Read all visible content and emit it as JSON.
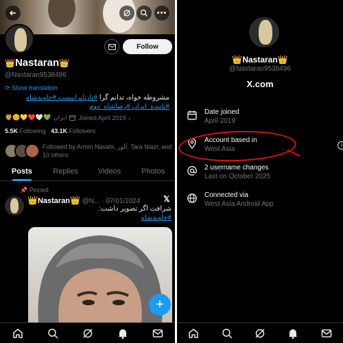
{
  "left": {
    "profile": {
      "name": "Nastaran",
      "crown_glyph": "👑",
      "handle": "@Nastaran9538496",
      "follow_label": "Follow",
      "show_translation": "Show translation",
      "bio_line1_text": "مشروطه خواه، تدانم گرا",
      "bio_line1_tags": "#یان‌ایرانیست #جاویدشاه",
      "bio_line2_tags": "#پاینده_ایران #رضاشاه_دوم",
      "location": "ایران",
      "joined": "Joined April 2019",
      "following_count": "5.5K",
      "following_label": "Following",
      "followers_count": "43.1K",
      "followers_label": "Followers",
      "followed_by": "Followed by Armin Navabi, آلور, Tara Niazi, and 10 others"
    },
    "tabs": [
      "Posts",
      "Replies",
      "Videos",
      "Photos"
    ],
    "post": {
      "pinned_label": "Pinned",
      "author": "Nastaran",
      "handle_date": "@N... · 07/01/2024",
      "text_line1": "شرافت اگر تصویر داشت:",
      "text_tag": "#جاویدشاه"
    },
    "nav_icons": [
      "home-icon",
      "search-icon",
      "grok-icon",
      "notifications-icon",
      "messages-icon"
    ]
  },
  "right": {
    "name": "Nastaran",
    "handle": "@Nastaran9538496",
    "brand": "X.com",
    "items": [
      {
        "title": "Date joined",
        "sub": "April 2019",
        "icon": "calendar-icon"
      },
      {
        "title": "Account based in",
        "sub": "West Asia",
        "icon": "location-pin-icon"
      },
      {
        "title": "2 username changes",
        "sub": "Last on October 2025",
        "icon": "at-icon"
      },
      {
        "title": "Connected via",
        "sub": "West Asia Android App",
        "icon": "globe-icon"
      }
    ],
    "nav_icons": [
      "home-icon",
      "search-icon",
      "grok-icon",
      "notifications-icon",
      "messages-icon"
    ]
  },
  "colors": {
    "accent": "#1d9bf0",
    "annotation": "#e01010",
    "background": "#000000"
  }
}
